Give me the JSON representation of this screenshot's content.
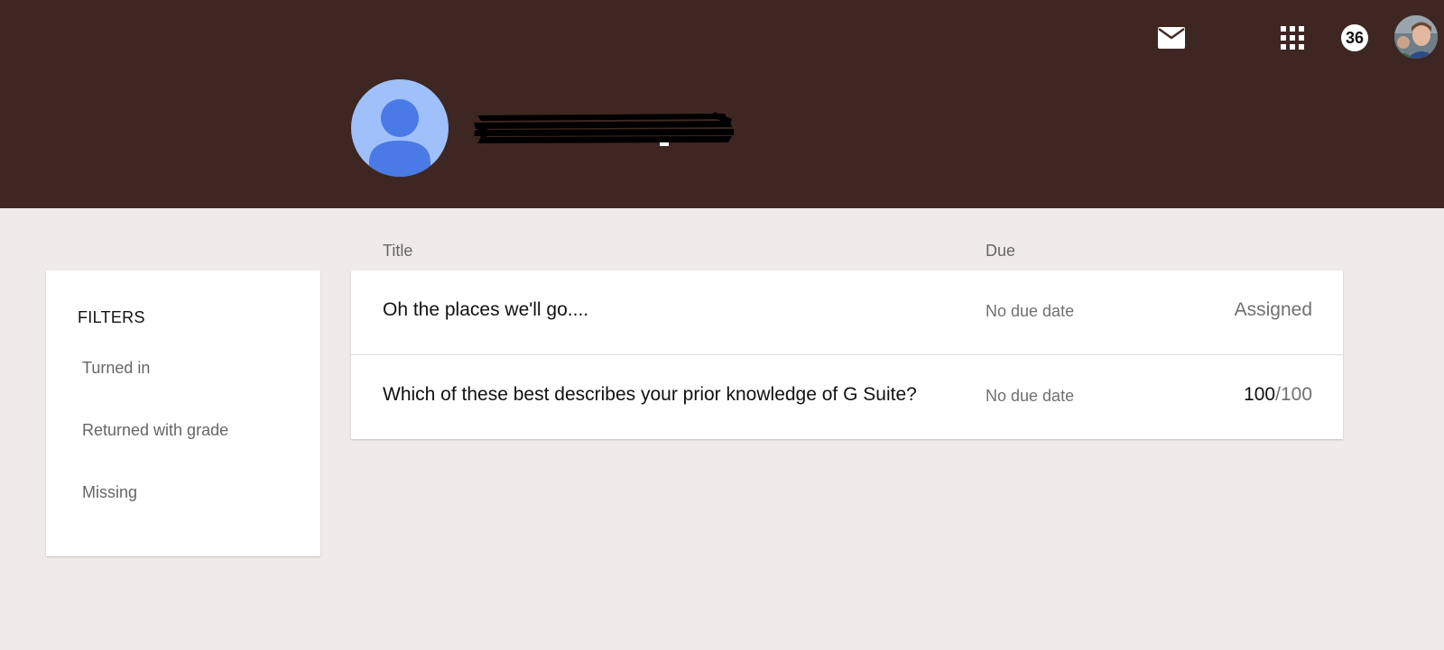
{
  "header": {
    "notifications_count": "36",
    "icons": [
      "mail-icon",
      "apps-grid-icon",
      "account-avatar"
    ],
    "colors": {
      "background": "#3e2723",
      "profile_photo_bg": "#a0c0fb",
      "profile_photo_fg": "#4a7ae5"
    }
  },
  "filters": {
    "title": "FILTERS",
    "items": [
      {
        "label": "Turned in"
      },
      {
        "label": "Returned with grade"
      },
      {
        "label": "Missing"
      }
    ]
  },
  "columns": {
    "title": "Title",
    "due": "Due"
  },
  "assignments": [
    {
      "title": "Oh the places we'll go....",
      "due": "No due date",
      "status": "Assigned"
    },
    {
      "title": "Which of these best describes your prior knowledge of G Suite?",
      "due": "No due date",
      "grade": "100",
      "grade_total": "/100"
    }
  ],
  "page": {
    "background": "#efebe8"
  }
}
